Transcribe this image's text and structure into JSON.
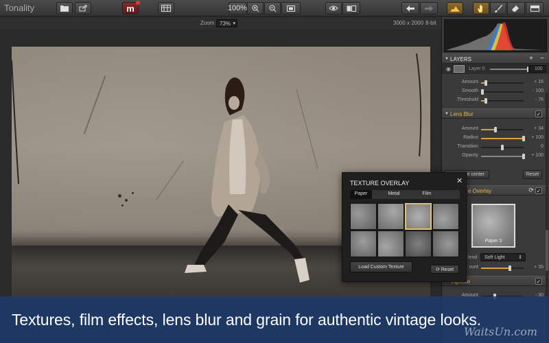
{
  "app": {
    "title": "Tonality"
  },
  "toolbar": {
    "m_label": "m",
    "zoom_percent": "100%",
    "icons": [
      "open-folder-icon",
      "share-icon",
      "m-plugin-icon",
      "layout-icon",
      "zoom-in-icon",
      "zoom-out-icon",
      "fit-screen-icon",
      "preview-eye-icon",
      "compare-split-icon",
      "undo-icon",
      "redo-icon",
      "histogram-view-icon",
      "hand-tool-icon",
      "brush-tool-icon",
      "eraser-tool-icon",
      "gradient-tool-icon"
    ]
  },
  "zoombar": {
    "label": "Zoom",
    "value": "73%",
    "image_size": "3000 x 2000",
    "bit_depth": "8-bit"
  },
  "layers": {
    "title": "LAYERS",
    "add": "+",
    "remove": "−",
    "layer_name": "Layer 0",
    "layer_opacity": "100"
  },
  "grain": {
    "params": [
      {
        "label": "Amount",
        "value": "+ 16",
        "level": 0.12
      },
      {
        "label": "Smooth",
        "value": "- 100",
        "level": 0.0
      },
      {
        "label": "Threshold",
        "value": "- 76",
        "level": 0.12
      }
    ]
  },
  "lens_blur": {
    "title": "Lens Blur",
    "check": "✓",
    "params": [
      {
        "label": "Amount",
        "value": "+ 34",
        "level": 0.34
      },
      {
        "label": "Radius",
        "value": "+ 100",
        "level": 1.0
      },
      {
        "label": "Transition",
        "value": "0",
        "level": 0.5
      },
      {
        "label": "Opacity",
        "value": "+ 100",
        "level": 1.0
      }
    ],
    "center_label": "e center",
    "reset_label": "Reset"
  },
  "texture_section": {
    "title": "e Overlay",
    "check": "✓",
    "thumb_label": "Paper 3",
    "blend_label": "lend",
    "blend_value": "Soft Light",
    "amount_label": "ount",
    "amount_value": "+ 35",
    "amount_level": 0.68
  },
  "vignette": {
    "title": "Vignette",
    "check": "✓",
    "amount_label": "Amount",
    "amount_value": "- 30"
  },
  "popup": {
    "title": "TEXTURE OVERLAY",
    "close": "✕",
    "tabs": [
      "Paper",
      "Metal",
      "Film"
    ],
    "active_tab": "Paper",
    "selected_texture_index": 2,
    "load_button": "Load Custom Texture",
    "reset_button": "Reset"
  },
  "caption": "Textures, film effects, lens blur and grain for authentic vintage looks.",
  "watermark": "WaitsUn.com",
  "colors": {
    "accent": "#e6b84a",
    "caption_bg": "#1c3a6e"
  }
}
